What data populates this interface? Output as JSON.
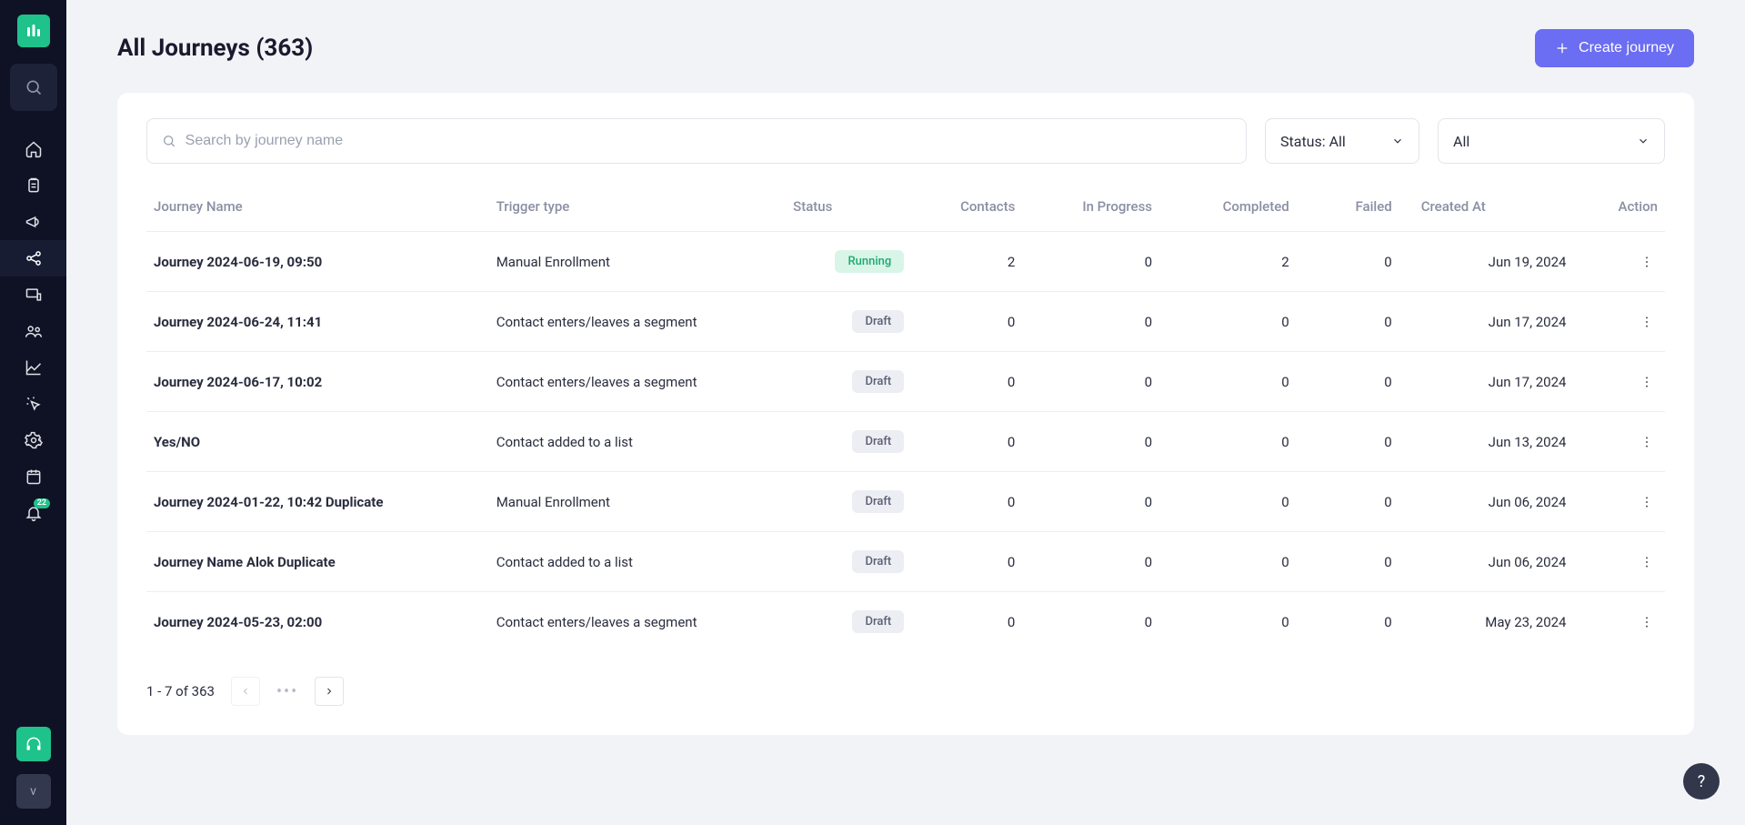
{
  "header": {
    "title": "All Journeys (363)",
    "create_label": "Create journey"
  },
  "filters": {
    "search_placeholder": "Search by journey name",
    "status_label": "Status: All",
    "scope_label": "All"
  },
  "columns": {
    "name": "Journey Name",
    "trigger": "Trigger type",
    "status": "Status",
    "contacts": "Contacts",
    "in_progress": "In Progress",
    "completed": "Completed",
    "failed": "Failed",
    "created_at": "Created At",
    "action": "Action"
  },
  "rows": [
    {
      "name": "Journey 2024-06-19, 09:50",
      "trigger": "Manual Enrollment",
      "status": "Running",
      "status_type": "running",
      "contacts": "2",
      "in_progress": "0",
      "completed": "2",
      "failed": "0",
      "created_at": "Jun 19, 2024"
    },
    {
      "name": "Journey 2024-06-24, 11:41",
      "trigger": "Contact enters/leaves a segment",
      "status": "Draft",
      "status_type": "draft",
      "contacts": "0",
      "in_progress": "0",
      "completed": "0",
      "failed": "0",
      "created_at": "Jun 17, 2024"
    },
    {
      "name": "Journey 2024-06-17, 10:02",
      "trigger": "Contact enters/leaves a segment",
      "status": "Draft",
      "status_type": "draft",
      "contacts": "0",
      "in_progress": "0",
      "completed": "0",
      "failed": "0",
      "created_at": "Jun 17, 2024"
    },
    {
      "name": "Yes/NO",
      "trigger": "Contact added to a list",
      "status": "Draft",
      "status_type": "draft",
      "contacts": "0",
      "in_progress": "0",
      "completed": "0",
      "failed": "0",
      "created_at": "Jun 13, 2024"
    },
    {
      "name": "Journey 2024-01-22, 10:42 Duplicate",
      "trigger": "Manual Enrollment",
      "status": "Draft",
      "status_type": "draft",
      "contacts": "0",
      "in_progress": "0",
      "completed": "0",
      "failed": "0",
      "created_at": "Jun 06, 2024"
    },
    {
      "name": "Journey Name Alok Duplicate",
      "trigger": "Contact added to a list",
      "status": "Draft",
      "status_type": "draft",
      "contacts": "0",
      "in_progress": "0",
      "completed": "0",
      "failed": "0",
      "created_at": "Jun 06, 2024"
    },
    {
      "name": "Journey 2024-05-23, 02:00",
      "trigger": "Contact enters/leaves a segment",
      "status": "Draft",
      "status_type": "draft",
      "contacts": "0",
      "in_progress": "0",
      "completed": "0",
      "failed": "0",
      "created_at": "May 23, 2024"
    }
  ],
  "pagination": {
    "range": "1 - 7 of 363"
  },
  "sidebar": {
    "avatar_initial": "v",
    "notification_badge": "22"
  },
  "help": {
    "label": "?"
  }
}
